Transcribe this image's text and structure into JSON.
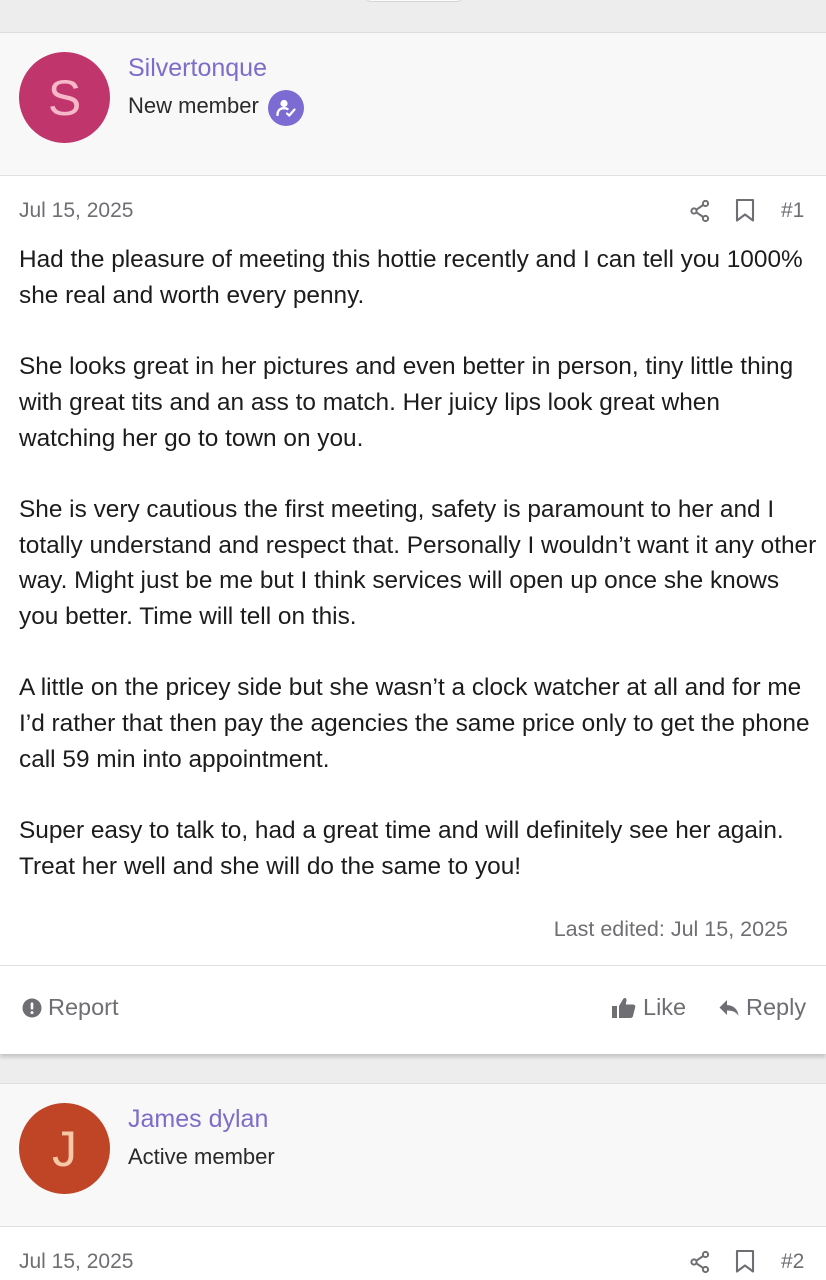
{
  "post1": {
    "avatar_letter": "S",
    "avatar_color": "#c0356b",
    "username": "Silvertonque",
    "user_title": "New member",
    "date": "Jul 15, 2025",
    "post_number": "#1",
    "paragraphs": [
      "Had the pleasure of meeting this hottie recently and I can tell you 1000% she real and worth every penny.",
      "She looks great in her pictures and even better in person, tiny little thing with great tits and an ass to match. Her juicy lips look great when watching her go to town on you.",
      "She is very cautious the first meeting, safety is paramount to her and I totally understand and respect that. Personally I wouldn’t want it any other way. Might just be me but I think services will open up once she knows you better. Time will tell on this.",
      "A little on the pricey side but she wasn’t a clock watcher at all and for me I’d rather that then pay the agencies the same price only to get the phone call 59 min into appointment.",
      "Super easy to talk to, had a great time and will definitely see her again. Treat her well and she will do the same to you!"
    ],
    "last_edited": "Last edited: Jul 15, 2025",
    "actions": {
      "report": "Report",
      "like": "Like",
      "reply": "Reply"
    }
  },
  "post2": {
    "avatar_letter": "J",
    "avatar_color": "#bf4526",
    "username": "James dylan",
    "user_title": "Active member",
    "date": "Jul 15, 2025",
    "post_number": "#2"
  },
  "icons": {
    "verified": "user-verified-icon",
    "share": "share-icon",
    "bookmark": "bookmark-icon",
    "report": "alert-circle-icon",
    "like": "thumbs-up-icon",
    "reply": "reply-arrow-icon"
  },
  "colors": {
    "username": "#7e6cc9",
    "meta_text": "#6f6f73",
    "verified_badge": "#7c6bd3"
  }
}
